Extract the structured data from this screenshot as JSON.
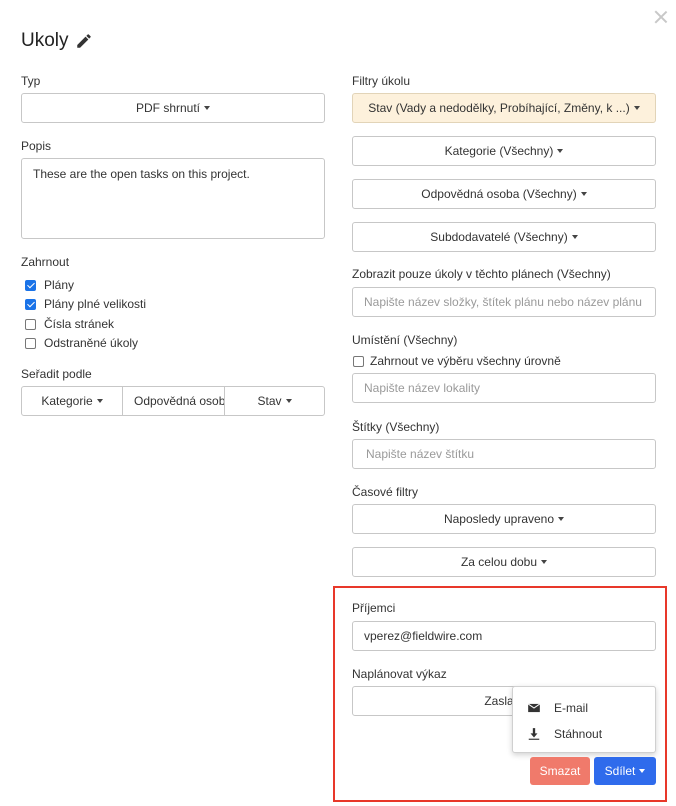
{
  "dialog": {
    "title": "Ukoly"
  },
  "left": {
    "type_label": "Typ",
    "type_value": "PDF shrnutí",
    "description_label": "Popis",
    "description_value": "These are the open tasks on this project.",
    "include_label": "Zahrnout",
    "include_options": [
      {
        "label": "Plány",
        "checked": true
      },
      {
        "label": "Plány plné velikosti",
        "checked": true
      },
      {
        "label": "Čísla stránek",
        "checked": false
      },
      {
        "label": "Odstraněné úkoly",
        "checked": false
      }
    ],
    "sort_label": "Seřadit podle",
    "sort_buttons": [
      "Kategorie",
      "Odpovědná osoba",
      "Stav"
    ]
  },
  "right": {
    "filters_label": "Filtry úkolu",
    "status_filter": "Stav (Vady a nedodělky, Probíhající, Změny, k ...)",
    "category_filter": "Kategorie (Všechny)",
    "responsible_filter": "Odpovědná osoba (Všechny)",
    "subcontractors_filter": "Subdodavatelé (Všechny)",
    "plans_label": "Zobrazit pouze úkoly v těchto plánech (Všechny)",
    "plans_placeholder": "Napište název složky, štítek plánu nebo název plánu",
    "location_label": "Umístění (Všechny)",
    "location_include_all": "Zahrnout ve výběru všechny úrovně",
    "location_placeholder": "Napište název lokality",
    "tags_label": "Štítky (Všechny)",
    "tags_placeholder": "Napište název štítku",
    "time_filters_label": "Časové filtry",
    "time_filter_1": "Naposledy upraveno",
    "time_filter_2": "Za celou dobu",
    "recipients_label": "Příjemci",
    "recipients_value": "vperez@fieldwire.com",
    "schedule_label": "Naplánovat výkaz",
    "schedule_button": "Zaslat t"
  },
  "share_menu": {
    "items": [
      {
        "label": "E-mail",
        "icon": "envelope-icon"
      },
      {
        "label": "Stáhnout",
        "icon": "download-icon"
      }
    ]
  },
  "footer": {
    "delete_label": "Smazat",
    "share_label": "Sdílet"
  },
  "colors": {
    "highlight_box": "#e8382a",
    "share_button": "#2f6bec",
    "delete_button": "#f07a6b",
    "status_filter_bg": "#fdf1dc"
  }
}
